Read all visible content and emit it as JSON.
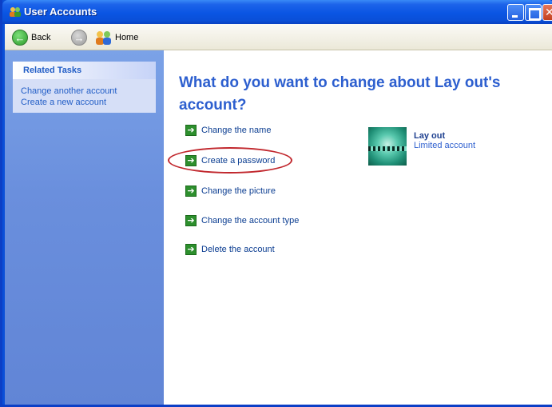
{
  "window": {
    "title": "User Accounts"
  },
  "toolbar": {
    "back_label": "Back",
    "home_label": "Home"
  },
  "sidebar": {
    "panel_title": "Related Tasks",
    "links": [
      {
        "label": "Change another account"
      },
      {
        "label": "Create a new account"
      }
    ]
  },
  "main": {
    "heading": "What do you want to change about Lay out's account?",
    "actions": [
      {
        "label": "Change the name"
      },
      {
        "label": "Create a password"
      },
      {
        "label": "Change the picture"
      },
      {
        "label": "Change the account type"
      },
      {
        "label": "Delete the account"
      }
    ],
    "highlighted_action": "Create a password"
  },
  "account": {
    "name": "Lay out",
    "type": "Limited account"
  },
  "icons": {
    "title": "user-accounts-icon",
    "back": "back-arrow-icon",
    "forward": "forward-arrow-icon",
    "home": "home-users-icon",
    "action": "green-arrow-icon"
  },
  "colors": {
    "titlebar": "#0a55e3",
    "sidebar": "#6a8fdd",
    "heading": "#2d5fcf",
    "link": "#215dc6",
    "highlight": "#c1272d",
    "action_arrow": "#2d8f2d"
  }
}
